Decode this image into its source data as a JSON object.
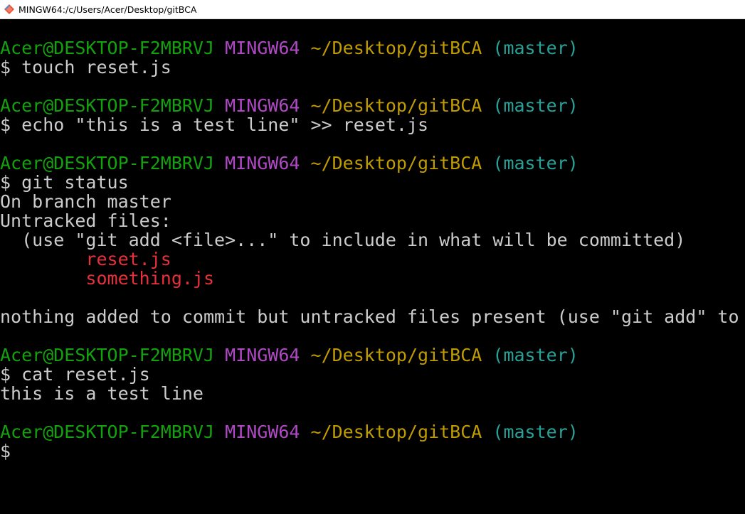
{
  "window": {
    "title": "MINGW64:/c/Users/Acer/Desktop/gitBCA",
    "icon": "git-bash-icon"
  },
  "colors": {
    "background": "#000000",
    "user_host": "#13a10e",
    "mingw": "#b148c6",
    "path": "#c19c00",
    "branch": "#2aa198",
    "untracked": "#e8303a",
    "text": "#cccccc"
  },
  "prompt": {
    "user_host": "Acer@DESKTOP-F2MBRVJ",
    "system": "MINGW64",
    "path": "~/Desktop/gitBCA",
    "branch": "(master)",
    "symbol": "$"
  },
  "session": {
    "cmd1": "touch reset.js",
    "cmd2": "echo \"this is a test line\" >> reset.js",
    "cmd3": "git status",
    "status_line1": "On branch master",
    "status_line2": "Untracked files:",
    "status_line3": "  (use \"git add <file>...\" to include in what will be committed)",
    "untracked1": "        reset.js",
    "untracked2": "        something.js",
    "status_line4": "nothing added to commit but untracked files present (use \"git add\" to track)",
    "cmd4": "cat reset.js",
    "cat_output": "this is a test line"
  }
}
